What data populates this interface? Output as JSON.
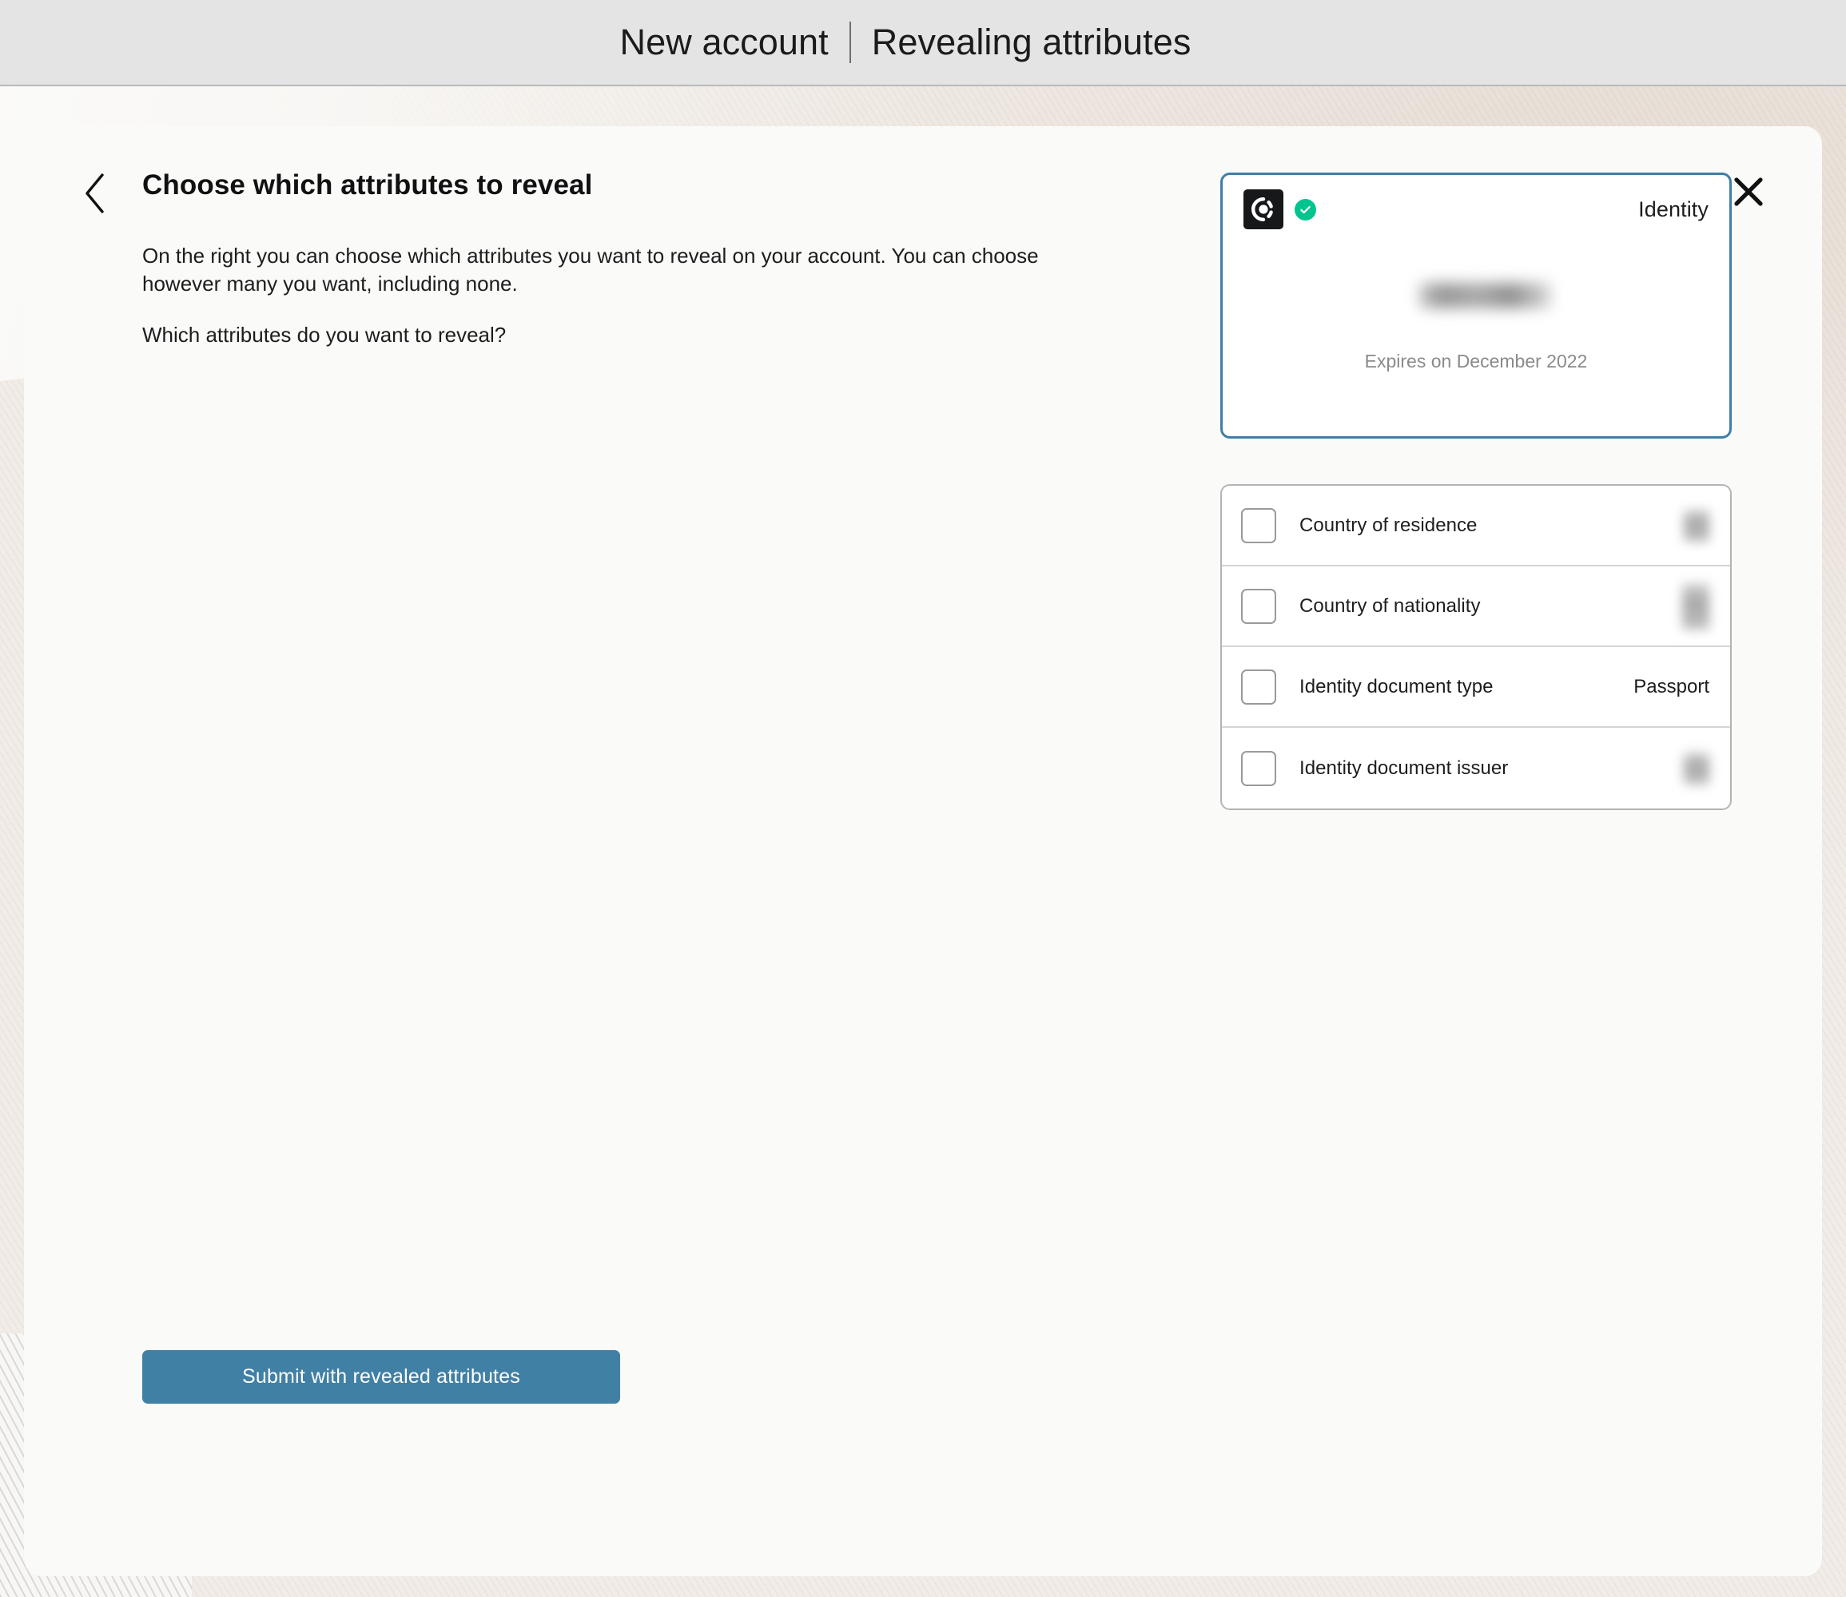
{
  "header": {
    "app_title": "New account",
    "section_title": "Revealing attributes"
  },
  "modal": {
    "back_icon": "chevron-left-icon",
    "close_icon": "close-icon",
    "page_title": "Choose which attributes to reveal",
    "intro_paragraph": "On the right you can choose which attributes you want to reveal on your account. You can choose however many you want, including none.",
    "question_paragraph": "Which attributes do you want to reveal?",
    "submit_label": "Submit with revealed attributes"
  },
  "identity_card": {
    "logo_icon": "yoti-logo-icon",
    "verified_icon": "verified-check-icon",
    "kind_label": "Identity",
    "holder_name": "",
    "holder_name_redacted": true,
    "expiry_text": "Expires on December 2022",
    "border_color": "#3d7fa6"
  },
  "attributes": [
    {
      "label": "Country of residence",
      "value": "",
      "redacted": true,
      "checked": false
    },
    {
      "label": "Country of nationality",
      "value": "",
      "redacted": true,
      "checked": false
    },
    {
      "label": "Identity document type",
      "value": "Passport",
      "redacted": false,
      "checked": false
    },
    {
      "label": "Identity document issuer",
      "value": "",
      "redacted": true,
      "checked": false
    }
  ],
  "colors": {
    "accent": "#3d7fa6",
    "button": "#4180a5",
    "verified_green": "#00c58e",
    "page_background": "#e4e4e4",
    "modal_background": "#fafaf9"
  }
}
